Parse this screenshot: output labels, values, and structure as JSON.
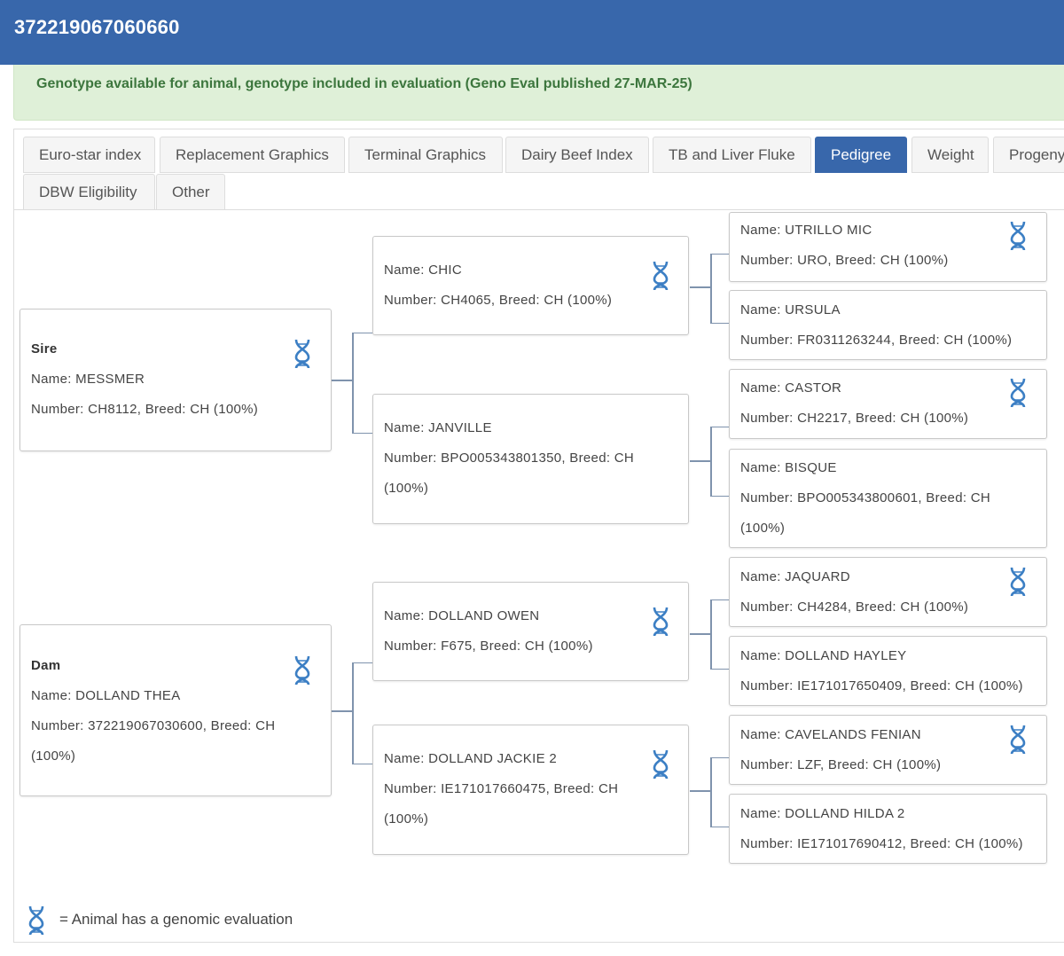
{
  "header": {
    "title": "372219067060660"
  },
  "alert": {
    "message": "Genotype available for animal, genotype included in evaluation (Geno Eval published 27-MAR-25)"
  },
  "tabs": [
    {
      "label": "Euro-star index",
      "active": false
    },
    {
      "label": "Replacement Graphics",
      "active": false
    },
    {
      "label": "Terminal Graphics",
      "active": false
    },
    {
      "label": "Dairy Beef Index",
      "active": false
    },
    {
      "label": "TB and Liver Fluke",
      "active": false
    },
    {
      "label": "Pedigree",
      "active": true
    },
    {
      "label": "Weight",
      "active": false
    },
    {
      "label": "Progeny",
      "active": false
    },
    {
      "label": "DBW Eligibility",
      "active": false
    },
    {
      "label": "Other",
      "active": false
    }
  ],
  "pedigree": {
    "sire": {
      "role": "Sire",
      "name": "Name: MESSMER",
      "number": "Number: CH8112, Breed: CH (100%)",
      "genomic": true
    },
    "dam": {
      "role": "Dam",
      "name": "Name: DOLLAND THEA",
      "number": "Number: 372219067030600, Breed: CH",
      "number2": "(100%)",
      "genomic": true
    },
    "sire_sire": {
      "name": "Name: CHIC",
      "number": "Number: CH4065, Breed: CH (100%)",
      "genomic": true
    },
    "sire_dam": {
      "name": "Name: JANVILLE",
      "number": "Number: BPO005343801350, Breed: CH",
      "number2": "(100%)",
      "genomic": false
    },
    "dam_sire": {
      "name": "Name: DOLLAND OWEN",
      "number": "Number: F675, Breed: CH (100%)",
      "genomic": true
    },
    "dam_dam": {
      "name": "Name: DOLLAND JACKIE 2",
      "number": "Number: IE171017660475, Breed: CH",
      "number2": "(100%)",
      "genomic": true
    },
    "gg1": {
      "name": "Name: UTRILLO MIC",
      "number": "Number: URO, Breed: CH (100%)",
      "genomic": true
    },
    "gg2": {
      "name": "Name: URSULA",
      "number": "Number: FR0311263244, Breed: CH (100%)",
      "genomic": false
    },
    "gg3": {
      "name": "Name: CASTOR",
      "number": "Number: CH2217, Breed: CH (100%)",
      "genomic": true
    },
    "gg4": {
      "name": "Name: BISQUE",
      "number": "Number: BPO005343800601, Breed: CH",
      "number2": "(100%)",
      "genomic": false
    },
    "gg5": {
      "name": "Name: JAQUARD",
      "number": "Number: CH4284, Breed: CH (100%)",
      "genomic": true
    },
    "gg6": {
      "name": "Name: DOLLAND HAYLEY",
      "number": "Number: IE171017650409, Breed: CH (100%)",
      "genomic": false
    },
    "gg7": {
      "name": "Name: CAVELANDS FENIAN",
      "number": "Number: LZF, Breed: CH (100%)",
      "genomic": true
    },
    "gg8": {
      "name": "Name: DOLLAND HILDA 2",
      "number": "Number: IE171017690412, Breed: CH (100%)",
      "genomic": false
    }
  },
  "legend": {
    "icon": "dna-icon",
    "text": "= Animal has a genomic evaluation"
  },
  "colors": {
    "header": "#3867ab",
    "alert_bg": "#dff0d8",
    "alert_text": "#3c763d",
    "dna": "#3c7fc4"
  }
}
